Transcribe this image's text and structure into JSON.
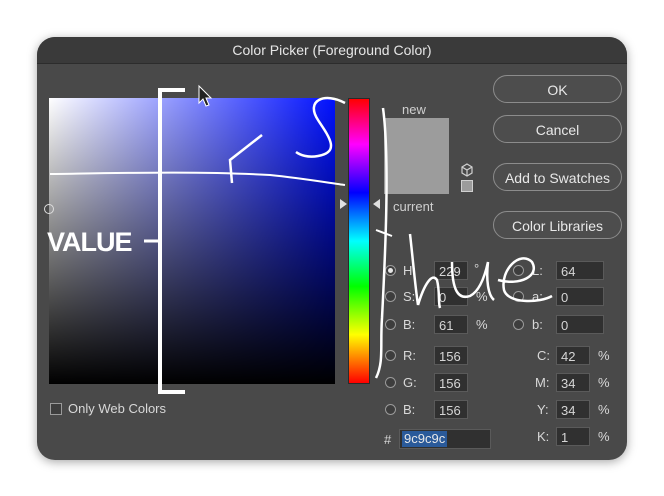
{
  "window": {
    "title": "Color Picker (Foreground Color)"
  },
  "buttons": {
    "ok": "OK",
    "cancel": "Cancel",
    "add_to_swatches": "Add to Swatches",
    "color_libraries": "Color Libraries"
  },
  "preview": {
    "new_label": "new",
    "current_label": "current",
    "new_color": "#9c9c9c",
    "current_color": "#9c9c9c"
  },
  "hsb": {
    "h": {
      "label": "H:",
      "value": "229",
      "unit": "°"
    },
    "s": {
      "label": "S:",
      "value": "0",
      "unit": "%"
    },
    "b": {
      "label": "B:",
      "value": "61",
      "unit": "%"
    }
  },
  "rgb": {
    "r": {
      "label": "R:",
      "value": "156"
    },
    "g": {
      "label": "G:",
      "value": "156"
    },
    "b": {
      "label": "B:",
      "value": "156"
    }
  },
  "lab": {
    "l": {
      "label": "L:",
      "value": "64"
    },
    "a": {
      "label": "a:",
      "value": "0"
    },
    "b": {
      "label": "b:",
      "value": "0"
    }
  },
  "cmyk": {
    "c": {
      "label": "C:",
      "value": "42",
      "unit": "%"
    },
    "m": {
      "label": "M:",
      "value": "34",
      "unit": "%"
    },
    "y": {
      "label": "Y:",
      "value": "34",
      "unit": "%"
    },
    "k": {
      "label": "K:",
      "value": "1",
      "unit": "%"
    }
  },
  "hex": {
    "label": "#",
    "value": "9c9c9c"
  },
  "web_colors": {
    "label": "Only Web Colors"
  },
  "annotations": {
    "value_text": "VALUE",
    "s_text": "S",
    "hue_text": "hue"
  },
  "colors": {
    "field_hue": "#0010ff",
    "selection": "#2a5a9a"
  }
}
